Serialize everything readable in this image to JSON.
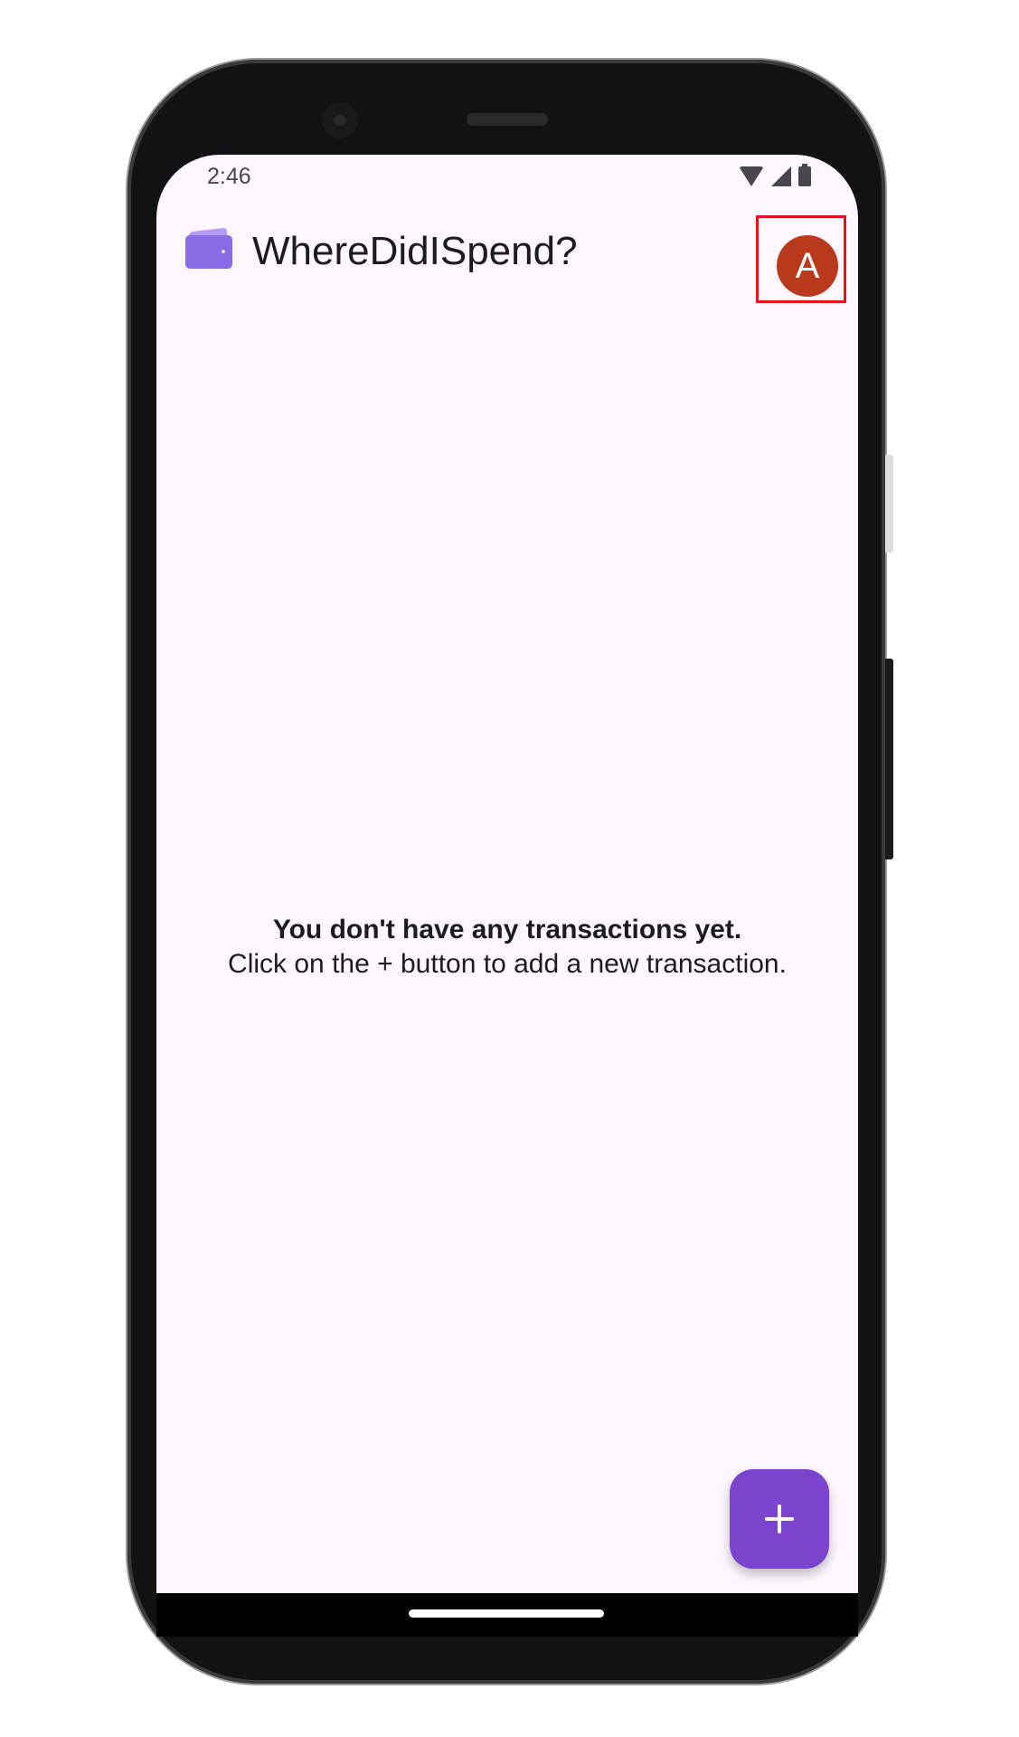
{
  "status_bar": {
    "time": "2:46",
    "icons": [
      "wifi-icon",
      "cell-signal-icon",
      "battery-icon"
    ]
  },
  "app_bar": {
    "title": "WhereDidISpend?",
    "logo_icon": "wallet-icon",
    "avatar_letter": "A"
  },
  "empty_state": {
    "title": "You don't have any transactions yet.",
    "subtitle_before": "Click on the ",
    "subtitle_symbol": "+",
    "subtitle_after": " button to add a new transaction."
  },
  "fab": {
    "icon": "plus-icon"
  },
  "colors": {
    "background": "#fef7ff",
    "avatar": "#b93a1d",
    "fab": "#7a44cc",
    "wallet": "#8c6be6",
    "highlight": "#e8121f"
  }
}
